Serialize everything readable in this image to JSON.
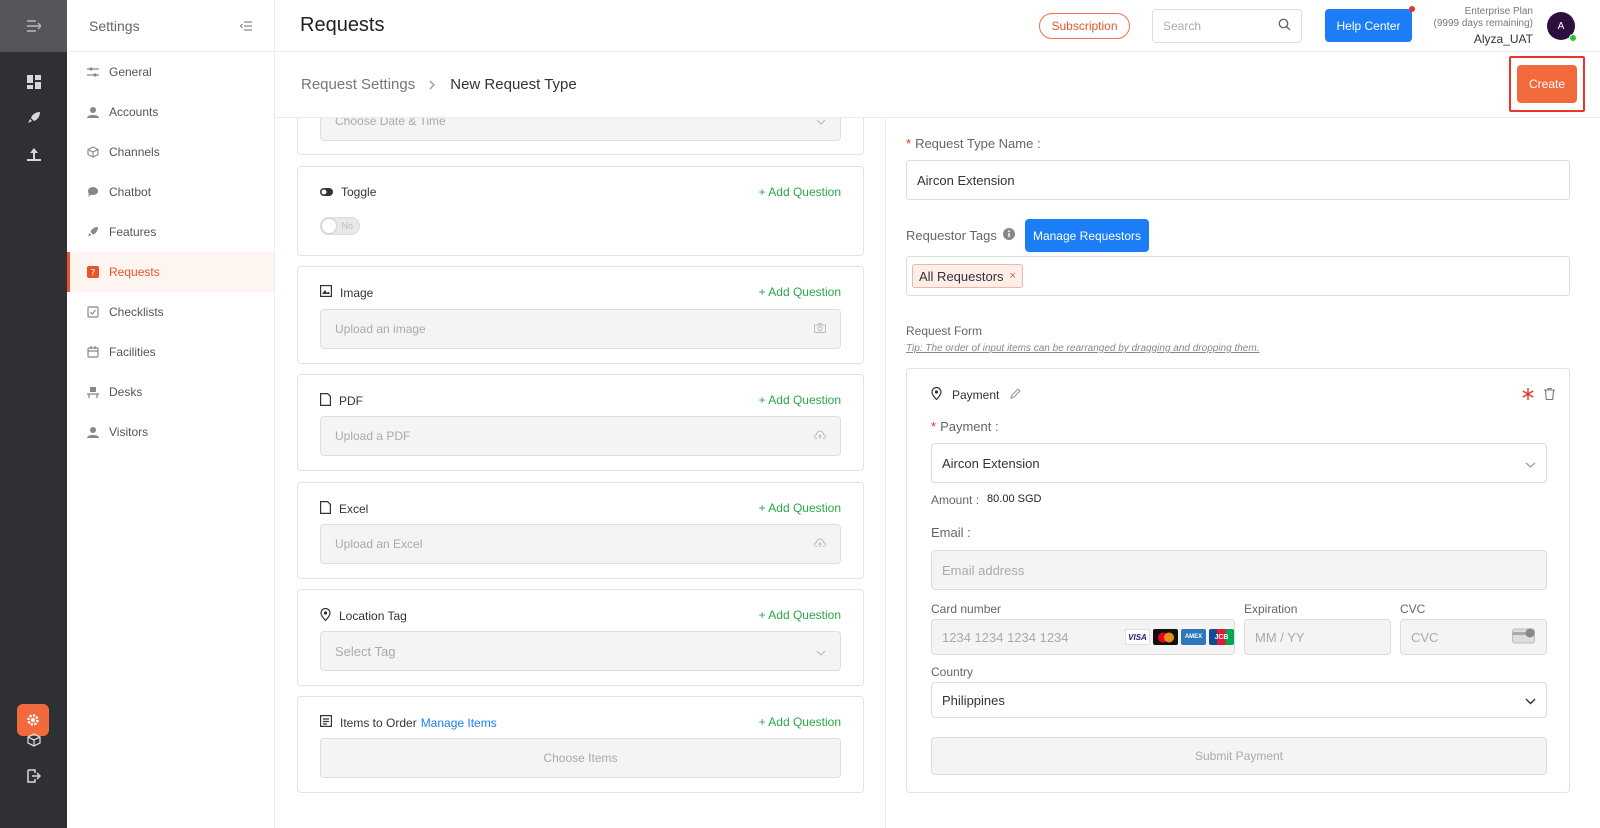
{
  "app": {
    "settings_title": "Settings",
    "page_title": "Requests"
  },
  "sidebar": {
    "items": [
      {
        "label": "General"
      },
      {
        "label": "Accounts"
      },
      {
        "label": "Channels"
      },
      {
        "label": "Chatbot"
      },
      {
        "label": "Features"
      },
      {
        "label": "Requests"
      },
      {
        "label": "Checklists"
      },
      {
        "label": "Facilities"
      },
      {
        "label": "Desks"
      },
      {
        "label": "Visitors"
      }
    ],
    "active": "Requests"
  },
  "header": {
    "subscription_label": "Subscription",
    "search_placeholder": "Search",
    "help_label": "Help Center",
    "plan_name": "Enterprise Plan",
    "plan_remaining": "(9999 days remaining)",
    "user_name": "Alyza_UAT",
    "avatar_initial": "A"
  },
  "breadcrumb": {
    "parent": "Request Settings",
    "current": "New Request Type"
  },
  "actions": {
    "create_label": "Create"
  },
  "question_types": {
    "date_placeholder": "Choose Date & Time",
    "add_question": "+ Add Question",
    "toggle": {
      "label": "Toggle",
      "value": "No"
    },
    "image": {
      "label": "Image",
      "placeholder": "Upload an image"
    },
    "pdf": {
      "label": "PDF",
      "placeholder": "Upload a PDF"
    },
    "excel": {
      "label": "Excel",
      "placeholder": "Upload an Excel"
    },
    "location": {
      "label": "Location Tag",
      "placeholder": "Select Tag"
    },
    "items": {
      "label": "Items to Order",
      "manage_label": "Manage Items",
      "placeholder": "Choose Items"
    }
  },
  "form": {
    "name_label": "Request Type Name",
    "name_value": "Aircon Extension",
    "requestor_tags_label": "Requestor Tags",
    "manage_requestors_label": "Manage Requestors",
    "tag_value": "All Requestors",
    "request_form_label": "Request Form",
    "tip": "Tip: The order of input items can be rearranged by dragging and dropping them."
  },
  "payment": {
    "card_title": "Payment",
    "field_label": "Payment",
    "selected": "Aircon Extension",
    "amount_label": "Amount",
    "amount_value": "80.00 SGD",
    "email_label": "Email",
    "email_placeholder": "Email address",
    "card_number_label": "Card number",
    "card_number_placeholder": "1234 1234 1234 1234",
    "expiration_label": "Expiration",
    "expiration_placeholder": "MM / YY",
    "cvc_label": "CVC",
    "cvc_placeholder": "CVC",
    "country_label": "Country",
    "country_value": "Philippines",
    "submit_label": "Submit Payment",
    "card_brands": [
      "VISA",
      "MC",
      "AMEX",
      "JCB"
    ]
  },
  "colors": {
    "accent": "#f26a3c",
    "primary_blue": "#1c7ef7",
    "add_green": "#2aa84a",
    "rail_bg": "#2f3034"
  }
}
